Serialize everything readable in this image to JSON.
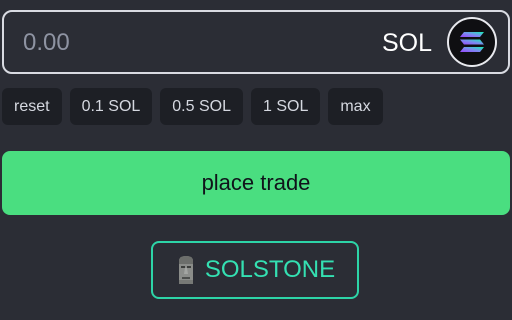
{
  "amount": {
    "placeholder": "0.00",
    "currency": "SOL",
    "currency_icon": "solana-logo-icon"
  },
  "quick_amounts": [
    "reset",
    "0.1 SOL",
    "0.5 SOL",
    "1 SOL",
    "max"
  ],
  "trade_button": {
    "label": "place trade"
  },
  "brand_button": {
    "label": "SOLSTONE",
    "icon": "moai-icon"
  },
  "colors": {
    "background": "#2b2d35",
    "accent_green": "#4ade80",
    "brand_teal": "#34e0b2",
    "quick_button_bg": "#1d1f25"
  }
}
